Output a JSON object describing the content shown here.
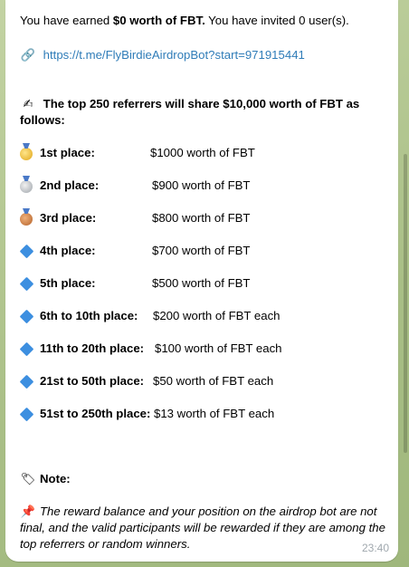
{
  "message": {
    "earned_prefix": "You have earned ",
    "earned_amount": "$0 worth of FBT.",
    "invited_text": " You have invited 0 user(s).",
    "link_emoji": "🔗",
    "link": "https://t.me/FlyBirdieAirdropBot?start=971915441",
    "intro_emoji": "✍",
    "intro_text": "The top 250 referrers will share $10,000 worth of  FBT as follows:",
    "places": [
      {
        "icon": "gold-medal",
        "label": "1st place:",
        "prize": "$1000 worth of FBT"
      },
      {
        "icon": "silver-medal",
        "label": "2nd place:",
        "prize": "$900 worth of FBT"
      },
      {
        "icon": "bronze-medal",
        "label": "3rd place:",
        "prize": "$800 worth of FBT"
      },
      {
        "icon": "blue-diamond",
        "label": "4th place:",
        "prize": "$700 worth of FBT"
      },
      {
        "icon": "blue-diamond",
        "label": "5th place:",
        "prize": "$500 worth of FBT"
      },
      {
        "icon": "blue-diamond",
        "label": "6th to 10th place:",
        "prize": "$200 worth of FBT each"
      },
      {
        "icon": "blue-diamond",
        "label": "11th to 20th place:",
        "prize": "$100 worth of FBT each"
      },
      {
        "icon": "blue-diamond",
        "label": "21st to 50th place:",
        "prize": "$50 worth of FBT each"
      },
      {
        "icon": "blue-diamond",
        "label": "51st to 250th place:",
        "prize": "$13 worth of FBT each"
      }
    ],
    "note_label": "Note:",
    "note_text": "The reward balance and your position on the airdrop bot are not final, and the valid participants will be rewarded if they are among the top referrers or random winners.",
    "time": "23:40"
  },
  "colors": {
    "link": "#2f7cb8",
    "bubble": "#ffffff",
    "background": "#b9c99a",
    "time": "#a0a8ae"
  }
}
